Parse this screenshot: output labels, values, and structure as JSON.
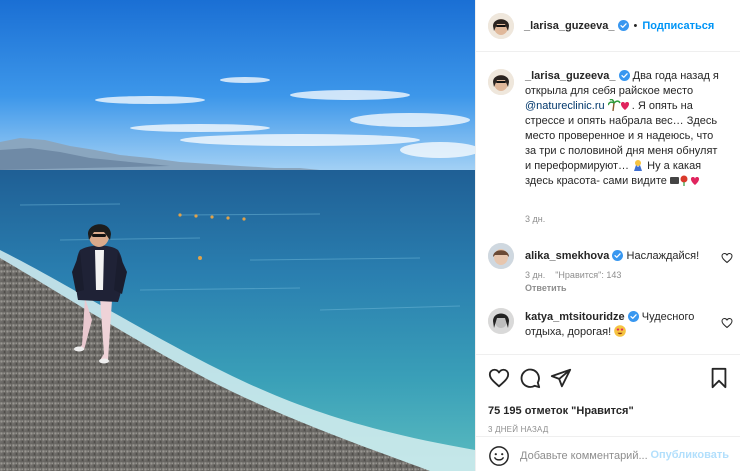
{
  "post": {
    "author": "_larisa_guzeeva_",
    "follow_label": "Подписаться",
    "separator": "•",
    "caption_parts": {
      "a": "Два года назад я открыла для себя райское место ",
      "mention": "@natureclinic.ru",
      "b": ". Я опять на стрессе и опять набрала вес… Здесь место проверенное и я надеюсь, что за три с половиной дня меня обнулят и переформируют… ",
      "c": " Ну а какая здесь красота- сами видите "
    },
    "caption_time": "3 дн.",
    "comments": [
      {
        "user": "alika_smekhova",
        "text": "Наслаждайся!",
        "time": "3 дн.",
        "likes": "\"Нравится\": 143",
        "reply": "Ответить"
      },
      {
        "user": "katya_mtsitouridze",
        "text": "Чудесного отдыха, дорогая!"
      }
    ],
    "likes_count": "75 195 отметок \"Нравится\"",
    "date": "3 ДНЕЙ НАЗАД",
    "comment_placeholder": "Добавьте комментарий...",
    "publish_label": "Опубликовать"
  },
  "icons": {
    "verified": "verified-badge-icon",
    "heart": "heart-icon",
    "comment": "comment-icon",
    "share": "share-icon",
    "save": "bookmark-icon",
    "emoji": "smiley-icon"
  },
  "colors": {
    "accent": "#0095f6",
    "mention": "#00376b",
    "muted": "#8e8e8e",
    "publish_disabled": "#b2dffc"
  }
}
